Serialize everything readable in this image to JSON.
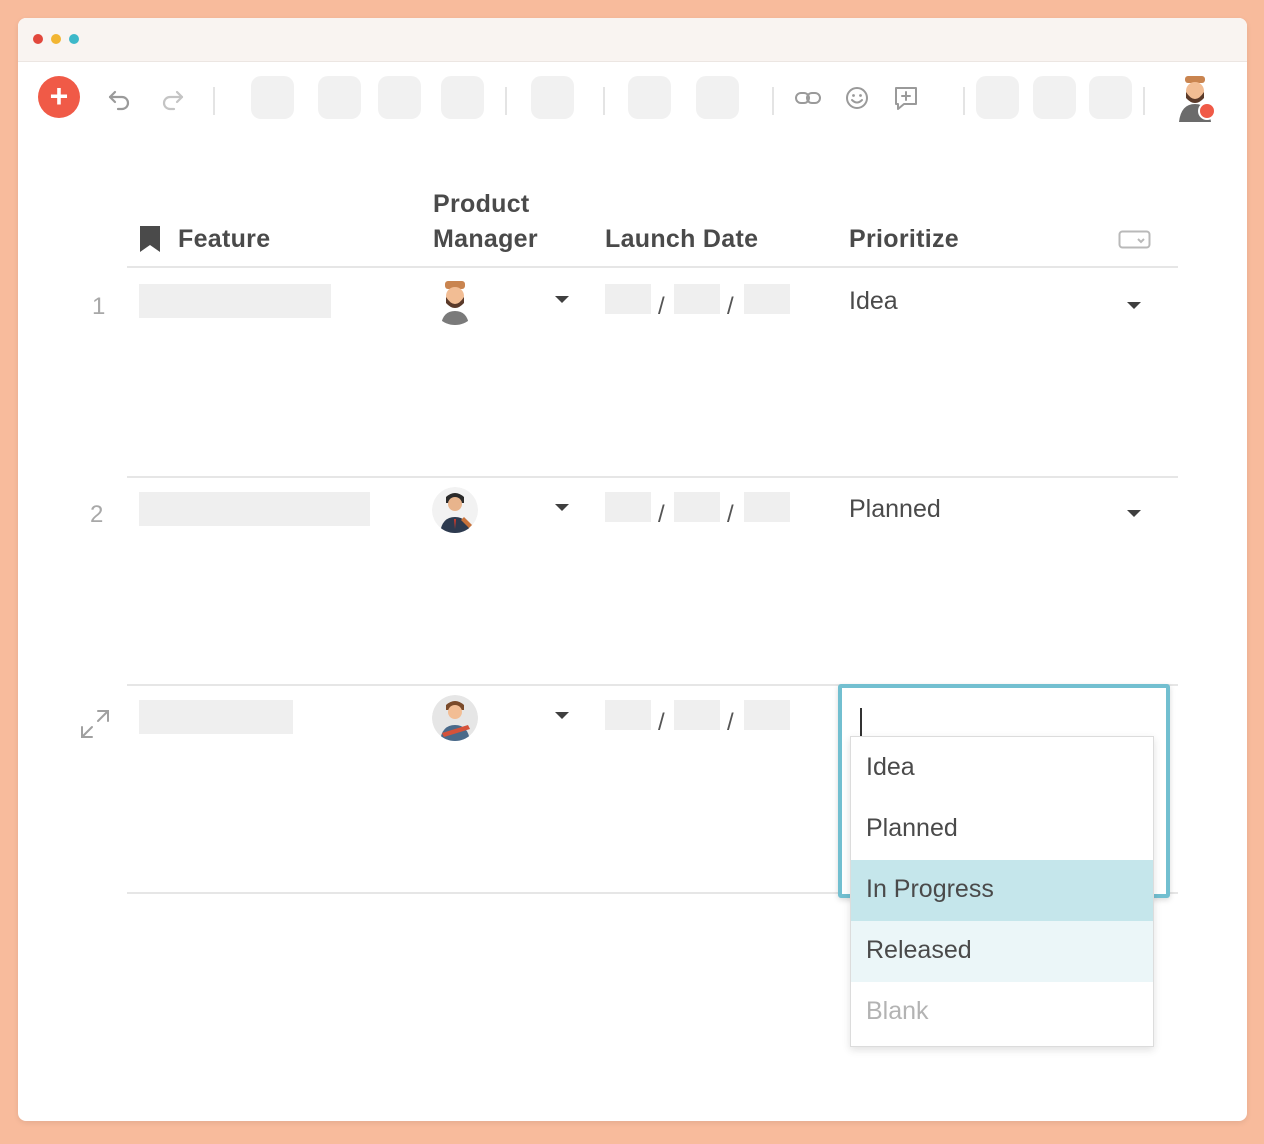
{
  "window": {
    "dots": [
      {
        "name": "close",
        "color": "#e2473c"
      },
      {
        "name": "minimize",
        "color": "#f2b532"
      },
      {
        "name": "zoom",
        "color": "#3db8c9"
      }
    ]
  },
  "toolbar": {
    "add_icon": "plus-icon",
    "undo_icon": "undo-icon",
    "redo_icon": "redo-icon",
    "link_icon": "link-icon",
    "emoji_icon": "smiley-icon",
    "comment_icon": "add-comment-icon",
    "accent_color": "#f05a47"
  },
  "table": {
    "columns": [
      {
        "key": "feature",
        "label": "Feature",
        "icon": "bookmark-icon"
      },
      {
        "key": "product_manager",
        "label_line1": "Product",
        "label_line2": "Manager"
      },
      {
        "key": "launch_date",
        "label": "Launch Date"
      },
      {
        "key": "prioritize",
        "label": "Prioritize"
      },
      {
        "key": "options",
        "icon": "column-options-icon"
      }
    ],
    "rows": [
      {
        "number": "1",
        "feature": "",
        "manager_avatar": "bearded-man-avatar",
        "launch_date": {
          "month": "",
          "day": "",
          "year": ""
        },
        "date_sep": "/",
        "prioritize": "Idea"
      },
      {
        "number": "2",
        "feature": "",
        "manager_avatar": "man-with-guitar-avatar",
        "launch_date": {
          "month": "",
          "day": "",
          "year": ""
        },
        "date_sep": "/",
        "prioritize": "Planned"
      },
      {
        "number": "",
        "expand_icon": "expand-icon",
        "feature": "",
        "manager_avatar": "man-with-bass-avatar",
        "launch_date": {
          "month": "",
          "day": "",
          "year": ""
        },
        "date_sep": "/",
        "prioritize": ""
      }
    ]
  },
  "dropdown": {
    "input_value": "",
    "options": [
      {
        "label": "Idea",
        "state": "normal"
      },
      {
        "label": "Planned",
        "state": "normal"
      },
      {
        "label": "In Progress",
        "state": "selected"
      },
      {
        "label": "Released",
        "state": "hover"
      },
      {
        "label": "Blank",
        "state": "muted"
      }
    ],
    "colors": {
      "selected": "#c5e6eb",
      "hover": "#ebf6f8",
      "border": "#72bfd0",
      "muted_text": "#b3b3b3"
    }
  }
}
